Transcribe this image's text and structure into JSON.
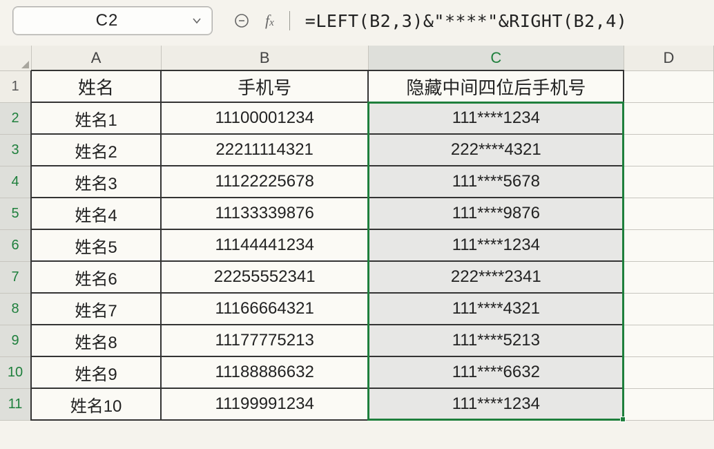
{
  "name_box": {
    "value": "C2"
  },
  "formula_bar": {
    "formula": "=LEFT(B2,3)&\"****\"&RIGHT(B2,4)"
  },
  "columns": [
    "A",
    "B",
    "C",
    "D"
  ],
  "row_numbers": [
    1,
    2,
    3,
    4,
    5,
    6,
    7,
    8,
    9,
    10,
    11
  ],
  "headers": {
    "A": "姓名",
    "B": "手机号",
    "C": "隐藏中间四位后手机号"
  },
  "rows": [
    {
      "name": "姓名1",
      "phone": "11100001234",
      "masked": "111****1234"
    },
    {
      "name": "姓名2",
      "phone": "22211114321",
      "masked": "222****4321"
    },
    {
      "name": "姓名3",
      "phone": "11122225678",
      "masked": "111****5678"
    },
    {
      "name": "姓名4",
      "phone": "11133339876",
      "masked": "111****9876"
    },
    {
      "name": "姓名5",
      "phone": "11144441234",
      "masked": "111****1234"
    },
    {
      "name": "姓名6",
      "phone": "22255552341",
      "masked": "222****2341"
    },
    {
      "name": "姓名7",
      "phone": "11166664321",
      "masked": "111****4321"
    },
    {
      "name": "姓名8",
      "phone": "11177775213",
      "masked": "111****5213"
    },
    {
      "name": "姓名9",
      "phone": "11188886632",
      "masked": "111****6632"
    },
    {
      "name": "姓名10",
      "phone": "11199991234",
      "masked": "111****1234"
    }
  ],
  "chart_data": {
    "type": "table",
    "columns": [
      "姓名",
      "手机号",
      "隐藏中间四位后手机号"
    ],
    "rows": [
      [
        "姓名1",
        "11100001234",
        "111****1234"
      ],
      [
        "姓名2",
        "22211114321",
        "222****4321"
      ],
      [
        "姓名3",
        "11122225678",
        "111****5678"
      ],
      [
        "姓名4",
        "11133339876",
        "111****9876"
      ],
      [
        "姓名5",
        "11144441234",
        "111****1234"
      ],
      [
        "姓名6",
        "22255552341",
        "222****2341"
      ],
      [
        "姓名7",
        "11166664321",
        "111****4321"
      ],
      [
        "姓名8",
        "11177775213",
        "111****5213"
      ],
      [
        "姓名9",
        "11188886632",
        "111****6632"
      ],
      [
        "姓名10",
        "11199991234",
        "111****1234"
      ]
    ]
  }
}
